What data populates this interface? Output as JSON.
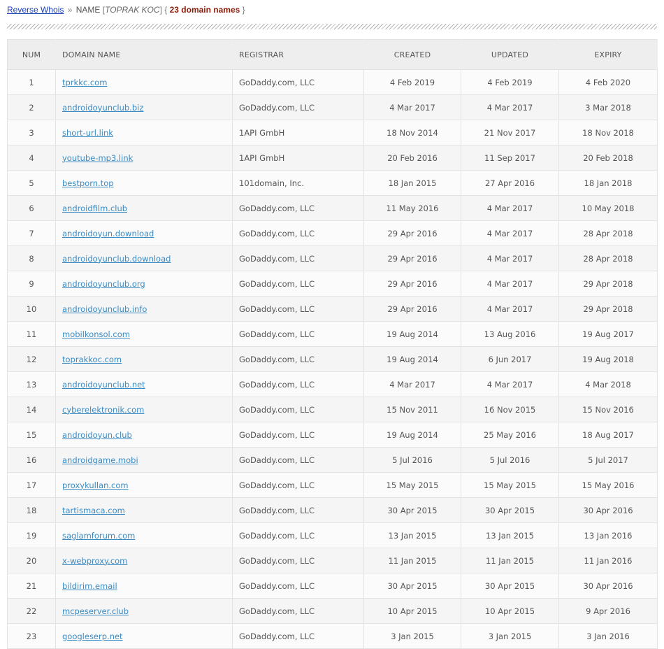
{
  "breadcrumb": {
    "link": "Reverse Whois",
    "separator": "»",
    "name_label": "NAME",
    "name_value": "TOPRAK KOC",
    "count": "23 domain names"
  },
  "table": {
    "headers": [
      "NUM",
      "DOMAIN NAME",
      "REGISTRAR",
      "CREATED",
      "UPDATED",
      "EXPIRY"
    ],
    "rows": [
      {
        "num": "1",
        "domain": "tprkkc.com",
        "registrar": "GoDaddy.com, LLC",
        "created": "4 Feb 2019",
        "updated": "4 Feb 2019",
        "expiry": "4 Feb 2020"
      },
      {
        "num": "2",
        "domain": "androidoyunclub.biz",
        "registrar": "GoDaddy.com, LLC",
        "created": "4 Mar 2017",
        "updated": "4 Mar 2017",
        "expiry": "3 Mar 2018"
      },
      {
        "num": "3",
        "domain": "short-url.link",
        "registrar": "1API GmbH",
        "created": "18 Nov 2014",
        "updated": "21 Nov 2017",
        "expiry": "18 Nov 2018"
      },
      {
        "num": "4",
        "domain": "youtube-mp3.link",
        "registrar": "1API GmbH",
        "created": "20 Feb 2016",
        "updated": "11 Sep 2017",
        "expiry": "20 Feb 2018"
      },
      {
        "num": "5",
        "domain": "bestporn.top",
        "registrar": "101domain, Inc.",
        "created": "18 Jan 2015",
        "updated": "27 Apr 2016",
        "expiry": "18 Jan 2018"
      },
      {
        "num": "6",
        "domain": "androidfilm.club",
        "registrar": "GoDaddy.com, LLC",
        "created": "11 May 2016",
        "updated": "4 Mar 2017",
        "expiry": "10 May 2018"
      },
      {
        "num": "7",
        "domain": "androidoyun.download",
        "registrar": "GoDaddy.com, LLC",
        "created": "29 Apr 2016",
        "updated": "4 Mar 2017",
        "expiry": "28 Apr 2018"
      },
      {
        "num": "8",
        "domain": "androidoyunclub.download",
        "registrar": "GoDaddy.com, LLC",
        "created": "29 Apr 2016",
        "updated": "4 Mar 2017",
        "expiry": "28 Apr 2018"
      },
      {
        "num": "9",
        "domain": "androidoyunclub.org",
        "registrar": "GoDaddy.com, LLC",
        "created": "29 Apr 2016",
        "updated": "4 Mar 2017",
        "expiry": "29 Apr 2018"
      },
      {
        "num": "10",
        "domain": "androidoyunclub.info",
        "registrar": "GoDaddy.com, LLC",
        "created": "29 Apr 2016",
        "updated": "4 Mar 2017",
        "expiry": "29 Apr 2018"
      },
      {
        "num": "11",
        "domain": "mobilkonsol.com",
        "registrar": "GoDaddy.com, LLC",
        "created": "19 Aug 2014",
        "updated": "13 Aug 2016",
        "expiry": "19 Aug 2017"
      },
      {
        "num": "12",
        "domain": "toprakkoc.com",
        "registrar": "GoDaddy.com, LLC",
        "created": "19 Aug 2014",
        "updated": "6 Jun 2017",
        "expiry": "19 Aug 2018"
      },
      {
        "num": "13",
        "domain": "androidoyunclub.net",
        "registrar": "GoDaddy.com, LLC",
        "created": "4 Mar 2017",
        "updated": "4 Mar 2017",
        "expiry": "4 Mar 2018"
      },
      {
        "num": "14",
        "domain": "cyberelektronik.com",
        "registrar": "GoDaddy.com, LLC",
        "created": "15 Nov 2011",
        "updated": "16 Nov 2015",
        "expiry": "15 Nov 2016"
      },
      {
        "num": "15",
        "domain": "androidoyun.club",
        "registrar": "GoDaddy.com, LLC",
        "created": "19 Aug 2014",
        "updated": "25 May 2016",
        "expiry": "18 Aug 2017"
      },
      {
        "num": "16",
        "domain": "androidgame.mobi",
        "registrar": "GoDaddy.com, LLC",
        "created": "5 Jul 2016",
        "updated": "5 Jul 2016",
        "expiry": "5 Jul 2017"
      },
      {
        "num": "17",
        "domain": "proxykullan.com",
        "registrar": "GoDaddy.com, LLC",
        "created": "15 May 2015",
        "updated": "15 May 2015",
        "expiry": "15 May 2016"
      },
      {
        "num": "18",
        "domain": "tartismaca.com",
        "registrar": "GoDaddy.com, LLC",
        "created": "30 Apr 2015",
        "updated": "30 Apr 2015",
        "expiry": "30 Apr 2016"
      },
      {
        "num": "19",
        "domain": "saglamforum.com",
        "registrar": "GoDaddy.com, LLC",
        "created": "13 Jan 2015",
        "updated": "13 Jan 2015",
        "expiry": "13 Jan 2016"
      },
      {
        "num": "20",
        "domain": "x-webproxy.com",
        "registrar": "GoDaddy.com, LLC",
        "created": "11 Jan 2015",
        "updated": "11 Jan 2015",
        "expiry": "11 Jan 2016"
      },
      {
        "num": "21",
        "domain": "bildirim.email",
        "registrar": "GoDaddy.com, LLC",
        "created": "30 Apr 2015",
        "updated": "30 Apr 2015",
        "expiry": "30 Apr 2016"
      },
      {
        "num": "22",
        "domain": "mcpeserver.club",
        "registrar": "GoDaddy.com, LLC",
        "created": "10 Apr 2015",
        "updated": "10 Apr 2015",
        "expiry": "9 Apr 2016"
      },
      {
        "num": "23",
        "domain": "googleserp.net",
        "registrar": "GoDaddy.com, LLC",
        "created": "3 Jan 2015",
        "updated": "3 Jan 2015",
        "expiry": "3 Jan 2016"
      }
    ]
  },
  "colors": {
    "link": "#1a3fb8",
    "domain_link": "#3b8bc2",
    "count": "#8a1c0c",
    "header_bg": "#eeeeee"
  }
}
